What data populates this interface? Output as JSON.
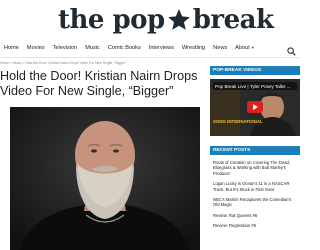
{
  "header": {
    "logo_left": "the pop",
    "logo_right": "break"
  },
  "nav": {
    "items": [
      {
        "label": "Home",
        "has_dropdown": false
      },
      {
        "label": "Movies",
        "has_dropdown": false
      },
      {
        "label": "Television",
        "has_dropdown": false
      },
      {
        "label": "Music",
        "has_dropdown": false
      },
      {
        "label": "Comic Books",
        "has_dropdown": false
      },
      {
        "label": "Interviews",
        "has_dropdown": false
      },
      {
        "label": "Wrestling",
        "has_dropdown": false
      },
      {
        "label": "News",
        "has_dropdown": false
      },
      {
        "label": "About",
        "has_dropdown": true
      }
    ],
    "search_icon": "search-icon"
  },
  "breadcrumb": "Home » Music » Hold the Door! Kristian Nairn Drops Video For New Single, \"Bigger\"",
  "article": {
    "headline": "Hold the Door! Kristian Nairn Drops Video For New Single, “Bigger”"
  },
  "sidebar": {
    "videos_header": "POP-BREAK VIDEOS",
    "video_title": "Pop Break Live | Tyler Posey Talks ...",
    "video_overlay_label": "SONG INTERNATIONAL",
    "recent_header": "RECENT POSTS",
    "recent_posts": [
      "Roots of Creation on Covering The Dead, Bluegrass & Working with Bob Marley's Producer",
      "Logan Lucky is Ocean's 11 in a NASCAR Track, But It's Stuck in First Gear",
      "NBC's Marlon Recaptures the Comedian's Old Magic",
      "Review: Rat Queens #6",
      "Review: Regression #6"
    ]
  },
  "colors": {
    "accent": "#1d7fb8",
    "logo": "#1f2a33",
    "play": "#e02020"
  }
}
